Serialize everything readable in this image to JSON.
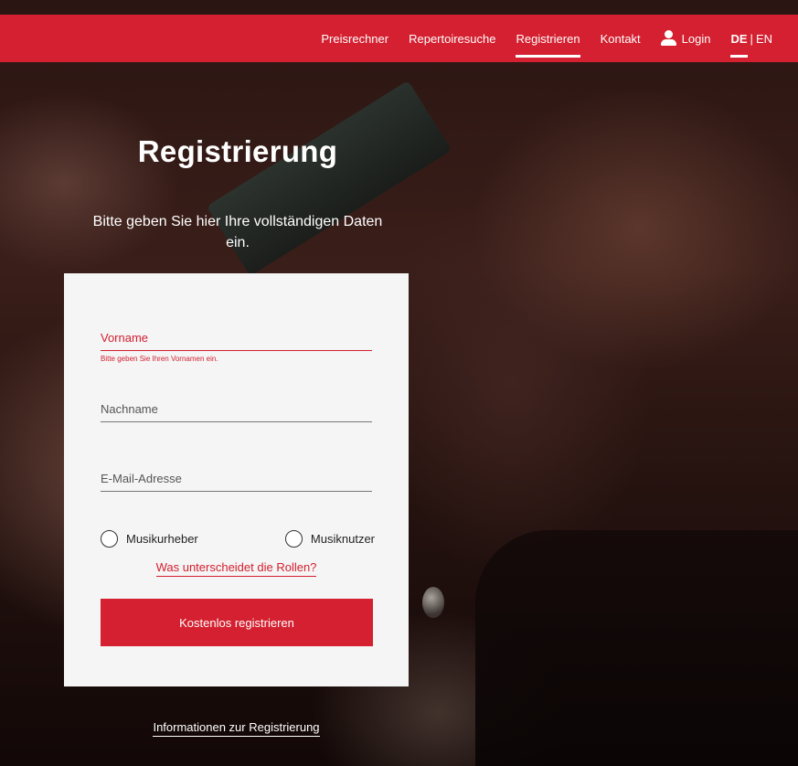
{
  "nav": {
    "items": [
      {
        "label": "Preisrechner"
      },
      {
        "label": "Repertoiresuche"
      },
      {
        "label": "Registrieren"
      },
      {
        "label": "Kontakt"
      }
    ],
    "login_label": "Login",
    "lang_de": "DE",
    "lang_separator": "|",
    "lang_en": "EN",
    "active_item": "Registrieren",
    "user_icon": "user-icon"
  },
  "hero": {
    "title": "Registrierung",
    "subtitle": "Bitte geben Sie hier Ihre vollständigen Daten ein."
  },
  "form": {
    "vorname": {
      "placeholder": "Vorname",
      "value": "",
      "error": "Bitte geben Sie Ihren Vornamen ein."
    },
    "nachname": {
      "placeholder": "Nachname",
      "value": ""
    },
    "email": {
      "placeholder": "E-Mail-Adresse",
      "value": ""
    },
    "roles": [
      {
        "label": "Musikurheber",
        "checked": false
      },
      {
        "label": "Musiknutzer",
        "checked": false
      }
    ],
    "roles_link": "Was unterscheidet die Rollen?",
    "submit_label": "Kostenlos registrieren"
  },
  "footer": {
    "info_link": "Informationen zur Registrierung"
  },
  "colors": {
    "brand_red": "#d42030",
    "card_bg": "#f5f5f5"
  }
}
